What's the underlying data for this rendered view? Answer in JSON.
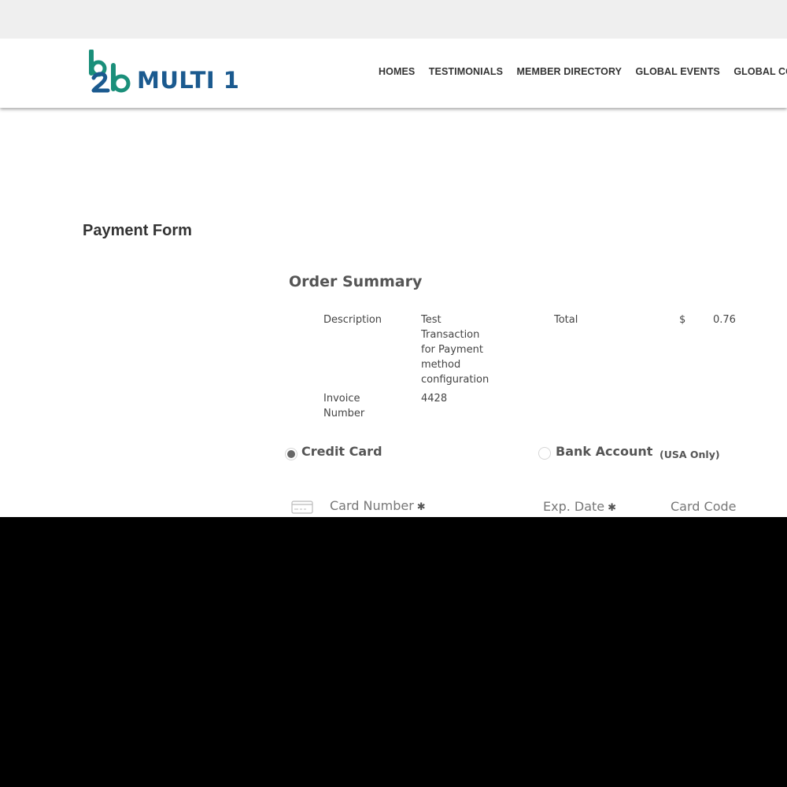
{
  "brand": {
    "name": "MULTI 1",
    "logo_mark": "b2b",
    "colors": {
      "blue": "#1b5a8f",
      "teal": "#1a8f7a"
    }
  },
  "nav": {
    "items": [
      "HOMES",
      "TESTIMONIALS",
      "MEMBER DIRECTORY",
      "GLOBAL EVENTS",
      "GLOBAL COMM"
    ]
  },
  "page": {
    "title": "Payment Form"
  },
  "order_summary": {
    "title": "Order Summary",
    "description_label": "Description",
    "description_value": [
      "Test",
      "Transaction",
      "for Payment",
      "method",
      "configuration"
    ],
    "total_label": "Total",
    "currency": "$",
    "total_value": "0.76",
    "invoice_label": [
      "Invoice",
      "Number"
    ],
    "invoice_value": "4428"
  },
  "payment_methods": {
    "credit_card": "Credit Card",
    "bank_account": "Bank Account",
    "bank_note": "(USA Only)",
    "selected": "credit_card"
  },
  "card_fields": {
    "card_number": "Card Number",
    "exp_date": "Exp. Date",
    "card_code": "Card Code",
    "required_mark": "✱",
    "icon": "credit-card-icon"
  }
}
